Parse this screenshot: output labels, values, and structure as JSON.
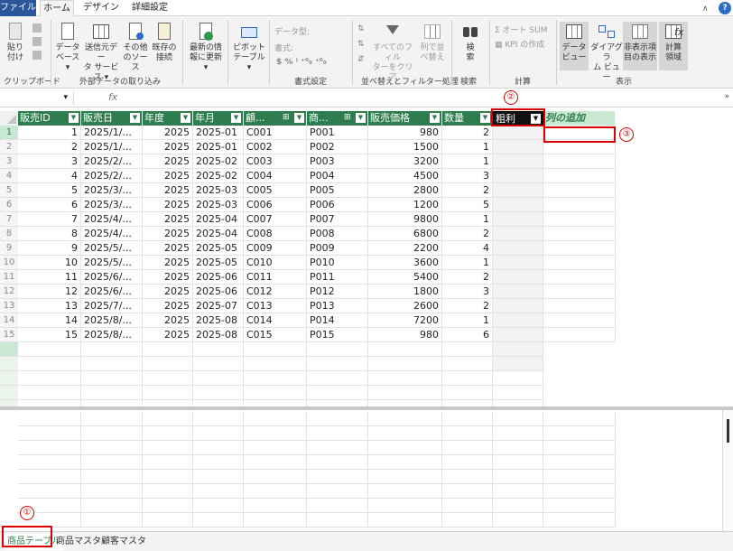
{
  "ribbon_tabs": [
    "ファイル",
    "ホーム",
    "デザイン",
    "詳細設定"
  ],
  "ribbon": {
    "clipboard": {
      "paste": "貼り付け",
      "paste_line1": "貼り",
      "paste_line2": "付け",
      "label": "クリップボード"
    },
    "external": {
      "db_line1": "データ",
      "db_line2": "ベース ▾",
      "svc_line1": "送信元デー",
      "svc_line2": "タ サービス ▾",
      "other_line1": "その他",
      "other_line2": "のソース",
      "existing_line1": "既存の",
      "existing_line2": "接続",
      "label": "外部データの取り込み"
    },
    "refresh": {
      "line1": "最新の情",
      "line2": "報に更新 ▾"
    },
    "pivot": {
      "line1": "ピボット",
      "line2": "テーブル ▾"
    },
    "format": {
      "datatype": "データ型:",
      "format": "書式:",
      "symbols": "$  %  ⁾  ⁺⁰₀  ⁺⁰₀",
      "label": "書式設定"
    },
    "sort": {
      "clear_line1": "すべてのフィル",
      "clear_line2": "ターをクリア",
      "colsort_line1": "列で並",
      "colsort_line2": "べ替え",
      "label": "並べ替えとフィルター処理"
    },
    "find": {
      "line1": "検",
      "line2": "索",
      "label": "検索"
    },
    "calc": {
      "autosum": "Σ オート SUM",
      "kpi": "KPI の作成",
      "label": "計算"
    },
    "view": {
      "dataview_line1": "データ",
      "dataview_line2": "ビュー",
      "diagram_line1": "ダイアグラ",
      "diagram_line2": "ム ビュー",
      "hidden_line1": "非表示項",
      "hidden_line2": "目の表示",
      "calcarea_line1": "計算",
      "calcarea_line2": "領域",
      "label": "表示"
    }
  },
  "formula_bar": {
    "fx": "fx",
    "namebox_caret": "▾",
    "expand": "»"
  },
  "table": {
    "columns": [
      "販売ID",
      "販売日",
      "年度",
      "年月",
      "顧...",
      "商...",
      "販売価格",
      "数量",
      "粗利",
      "列の追加"
    ],
    "rows": [
      [
        "1",
        "2025/1/...",
        "2025",
        "2025-01",
        "C001",
        "P001",
        "980",
        "2"
      ],
      [
        "2",
        "2025/1/...",
        "2025",
        "2025-01",
        "C002",
        "P002",
        "1500",
        "1"
      ],
      [
        "3",
        "2025/2/...",
        "2025",
        "2025-02",
        "C003",
        "P003",
        "3200",
        "1"
      ],
      [
        "4",
        "2025/2/...",
        "2025",
        "2025-02",
        "C004",
        "P004",
        "4500",
        "3"
      ],
      [
        "5",
        "2025/3/...",
        "2025",
        "2025-03",
        "C005",
        "P005",
        "2800",
        "2"
      ],
      [
        "6",
        "2025/3/...",
        "2025",
        "2025-03",
        "C006",
        "P006",
        "1200",
        "5"
      ],
      [
        "7",
        "2025/4/...",
        "2025",
        "2025-04",
        "C007",
        "P007",
        "9800",
        "1"
      ],
      [
        "8",
        "2025/4/...",
        "2025",
        "2025-04",
        "C008",
        "P008",
        "6800",
        "2"
      ],
      [
        "9",
        "2025/5/...",
        "2025",
        "2025-05",
        "C009",
        "P009",
        "2200",
        "4"
      ],
      [
        "10",
        "2025/5/...",
        "2025",
        "2025-05",
        "C010",
        "P010",
        "3600",
        "1"
      ],
      [
        "11",
        "2025/6/...",
        "2025",
        "2025-06",
        "C011",
        "P011",
        "5400",
        "2"
      ],
      [
        "12",
        "2025/6/...",
        "2025",
        "2025-06",
        "C012",
        "P012",
        "1800",
        "3"
      ],
      [
        "13",
        "2025/7/...",
        "2025",
        "2025-07",
        "C013",
        "P013",
        "2600",
        "2"
      ],
      [
        "14",
        "2025/8/...",
        "2025",
        "2025-08",
        "C014",
        "P014",
        "7200",
        "1"
      ],
      [
        "15",
        "2025/8/...",
        "2025",
        "2025-08",
        "C015",
        "P015",
        "980",
        "6"
      ]
    ]
  },
  "annotations": [
    "①",
    "②",
    "③"
  ],
  "sheet_tabs": [
    "商品テーブル",
    "商品マスタ",
    "顧客マスタ"
  ],
  "colors": {
    "header_green": "#2e7d4f",
    "highlight_red": "#dd0000",
    "file_tab_blue": "#2b579a"
  }
}
